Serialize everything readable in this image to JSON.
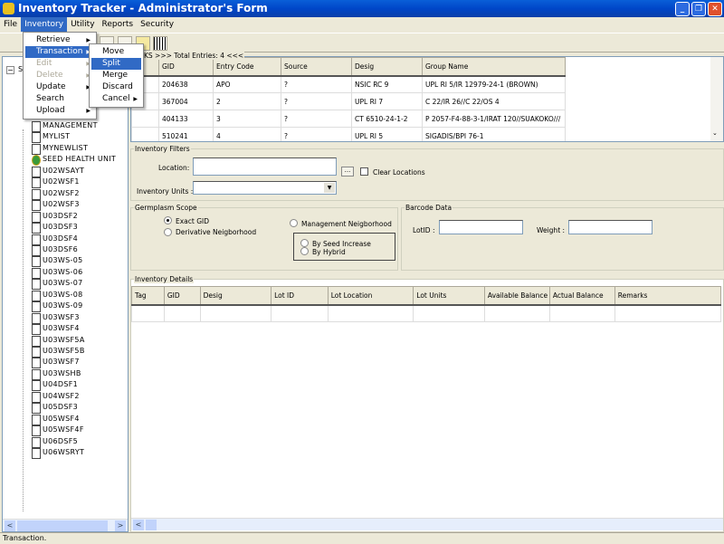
{
  "window": {
    "title": "Inventory Tracker - Administrator's Form",
    "minimize": "_",
    "restore": "❐",
    "close": "✕"
  },
  "menubar": [
    "File",
    "Inventory",
    "Utility",
    "Reports",
    "Security"
  ],
  "inventory_menu": [
    {
      "label": "Retrieve",
      "submenu": true,
      "enabled": true
    },
    {
      "label": "Transaction",
      "submenu": true,
      "enabled": true,
      "selected": true
    },
    {
      "label": "Edit",
      "submenu": true,
      "enabled": false
    },
    {
      "label": "Delete",
      "submenu": true,
      "enabled": false
    },
    {
      "label": "Update",
      "submenu": true,
      "enabled": true
    },
    {
      "label": "Search",
      "submenu": false,
      "enabled": true
    },
    {
      "label": "Upload",
      "submenu": true,
      "enabled": true
    }
  ],
  "transaction_menu": [
    {
      "label": "Move"
    },
    {
      "label": "Split",
      "selected": true
    },
    {
      "label": "Merge"
    },
    {
      "label": "Discard"
    },
    {
      "label": "Cancel",
      "submenu": true
    }
  ],
  "tree": {
    "root": "S",
    "partial": "RY",
    "items": [
      "MANAGEMENT",
      "MYLIST",
      "MYNEWLIST",
      "SEED HEALTH UNIT",
      "U02WSAYT",
      "U02WSF1",
      "U02WSF2",
      "U02WSF3",
      "U03DSF2",
      "U03DSF3",
      "U03DSF4",
      "U03DSF6",
      "U03WS-05",
      "U03WS-06",
      "U03WS-07",
      "U03WS-08",
      "U03WS-09",
      "U03WSF3",
      "U03WSF4",
      "U03WSF5A",
      "U03WSF5B",
      "U03WSF7",
      "U03WSHB",
      "U04DSF1",
      "U04WSF2",
      "U05DSF3",
      "U05WSF4",
      "U05WSF4F",
      "U06DSF5",
      "U06WSRYT"
    ]
  },
  "entries": {
    "caption": "ECKS >>> Total Entries: 4 <<<",
    "columns": [
      "",
      "GID",
      "Entry Code",
      "Source",
      "Desig",
      "Group Name"
    ],
    "rows": [
      [
        "",
        "204638",
        "APO",
        "?",
        "NSIC RC 9",
        "UPL RI 5/IR 12979-24-1 (BROWN)"
      ],
      [
        "",
        "367004",
        "2",
        "?",
        "UPL RI 7",
        "C 22/IR 26//C 22/OS 4"
      ],
      [
        "",
        "404133",
        "3",
        "?",
        "CT 6510-24-1-2",
        "P 2057-F4-88-3-1/IRAT 120//SUAKOKO///"
      ],
      [
        "",
        "510241",
        "4",
        "?",
        "UPL RI 5",
        "SIGADIS/BPI 76-1"
      ]
    ]
  },
  "filters": {
    "title": "Inventory Filters",
    "location_label": "Location:",
    "location_value": "",
    "browse": "...",
    "clear_label": "Clear Locations",
    "clear_checked": false,
    "units_label": "Inventory Units :",
    "units_value": ""
  },
  "scope": {
    "title": "Germplasm Scope",
    "exact": "Exact GID",
    "derivative": "Derivative Neigborhood",
    "management": "Management Neigborhood",
    "seed_increase": "By Seed Increase",
    "hybrid": "By Hybrid",
    "selected": "Exact GID"
  },
  "barcode": {
    "title": "Barcode Data",
    "lot_label": "LotID :",
    "lot_value": "",
    "weight_label": "Weight :",
    "weight_value": ""
  },
  "details": {
    "title": "Inventory Details",
    "columns": [
      "Tag",
      "GID",
      "Desig",
      "Lot ID",
      "Lot Location",
      "Lot Units",
      "Available Balance",
      "Actual Balance",
      "Remarks"
    ]
  },
  "status": "Transaction."
}
